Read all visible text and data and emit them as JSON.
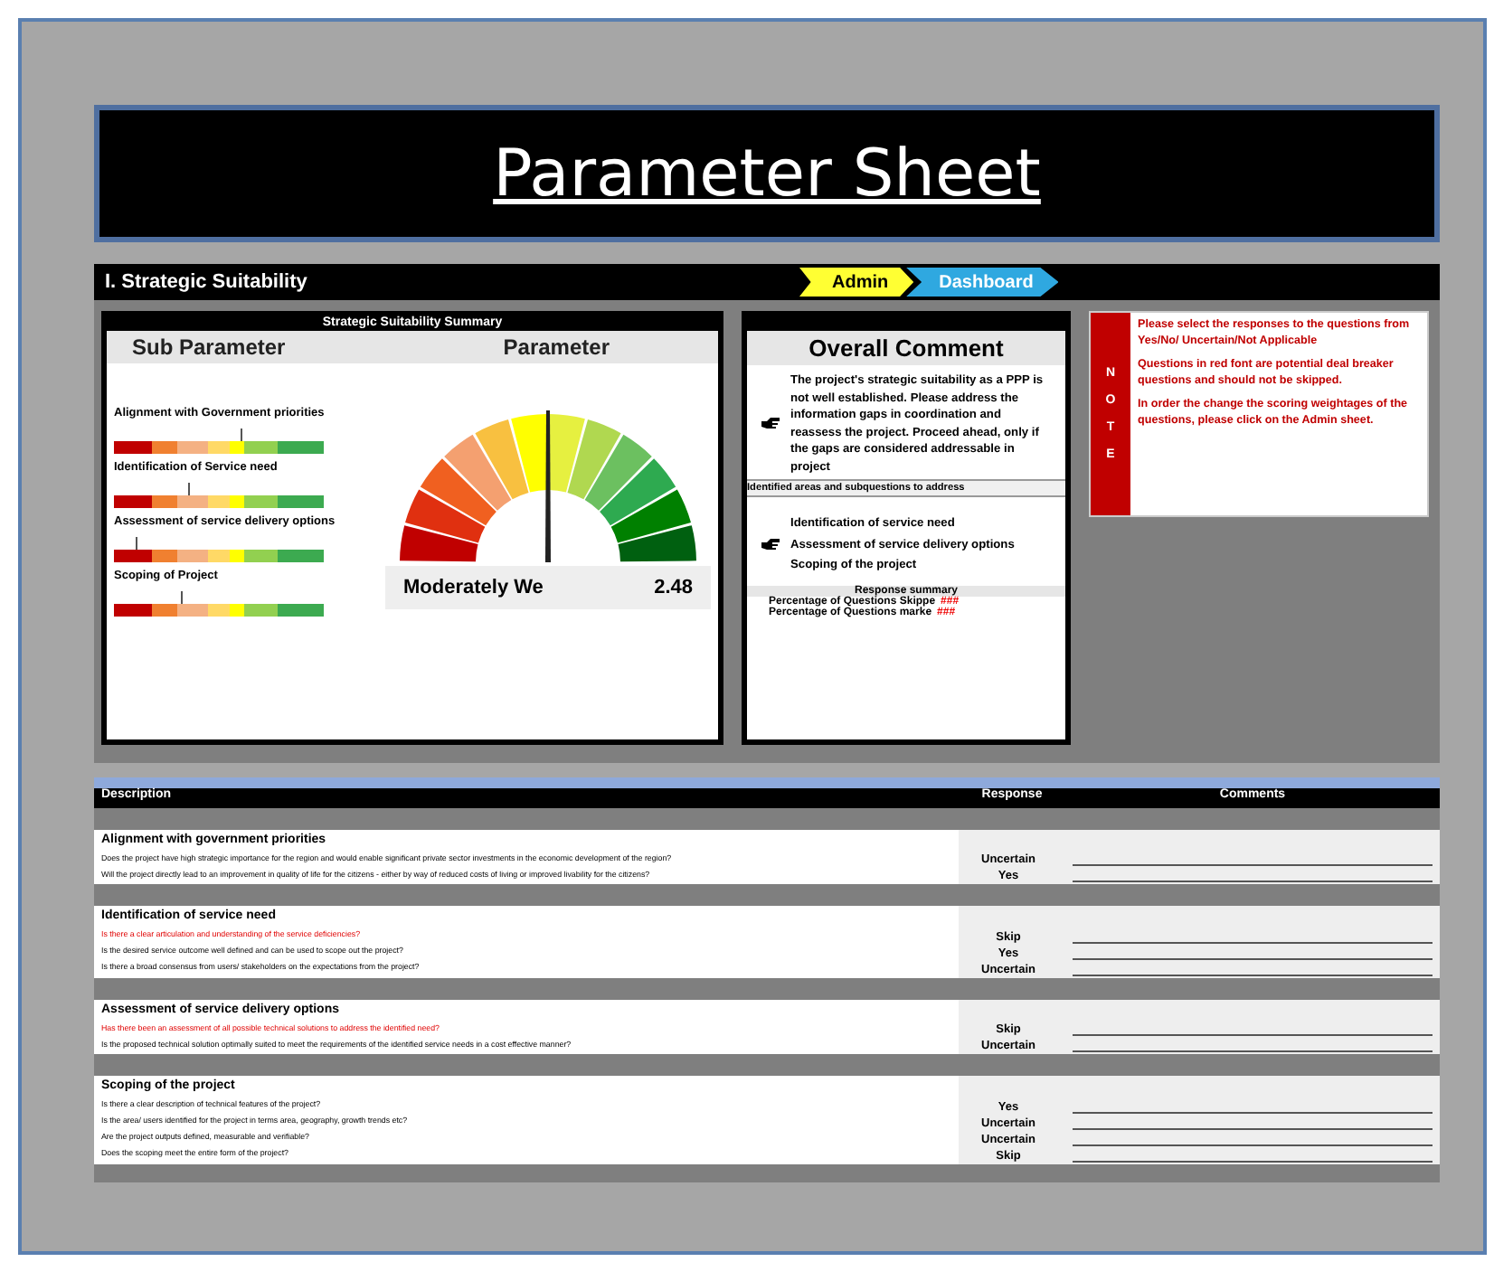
{
  "title": "Parameter Sheet",
  "section": {
    "title": "I. Strategic Suitability",
    "tabs": [
      {
        "label": "Admin",
        "kind": "admin"
      },
      {
        "label": "Dashboard",
        "kind": "dashboard"
      }
    ]
  },
  "summary": {
    "title": "Strategic Suitability Summary",
    "sub_heading": "Sub Parameter",
    "param_heading": "Parameter",
    "sub_parameters": [
      {
        "name": "Alignment with Government priorities",
        "level": 0.6
      },
      {
        "name": "Identification of Service need",
        "level": 0.35
      },
      {
        "name": "Assessment of service delivery options",
        "level": 0.1
      },
      {
        "name": "Scoping of Project",
        "level": 0.32
      }
    ],
    "gauge": {
      "rating": "Moderately We",
      "score": "2.48"
    }
  },
  "comment": {
    "title": "Overall Comment",
    "text": "The project's strategic suitability as a PPP is not well established. Please address the information gaps in coordination and reassess the project. Proceed ahead, only if the gaps are considered addressable in project",
    "areas_heading": "Identified areas and subquestions to address",
    "areas": [
      "Identification of service need",
      "Assessment of service delivery options",
      "Scoping of the project"
    ],
    "summary_title": "Response summary",
    "stats": [
      {
        "label": "Percentage of Questions Skippe",
        "value": "###"
      },
      {
        "label": "Percentage of Questions marke",
        "value": "###"
      }
    ]
  },
  "note": {
    "letters": [
      "N",
      "O",
      "T",
      "E"
    ],
    "paragraphs": [
      "Please select the responses to the questions from Yes/No/ Uncertain/Not Applicable",
      "Questions in red font are potential deal breaker questions and should not be skipped.",
      "In order the change the scoring weightages of the questions, please click on the Admin sheet."
    ]
  },
  "table": {
    "columns": [
      "Description",
      "Response",
      "Comments"
    ],
    "groups": [
      {
        "title": "Alignment with government priorities",
        "questions": [
          {
            "text": "Does the project have high strategic importance for the region and would enable significant private sector investments in the economic development of the region?",
            "critical": false,
            "response": "Uncertain"
          },
          {
            "text": "Will the project directly lead to an improvement in quality of life for the citizens - either by way of reduced costs of living or improved livability for the citizens?",
            "critical": false,
            "response": "Yes"
          }
        ]
      },
      {
        "title": "Identification of service need",
        "questions": [
          {
            "text": "Is there a clear articulation and understanding of the service deficiencies?",
            "critical": true,
            "response": "Skip"
          },
          {
            "text": "Is the desired service outcome well defined and can be used to scope out the project?",
            "critical": false,
            "response": "Yes"
          },
          {
            "text": "Is there a broad consensus from users/ stakeholders on the expectations from the project?",
            "critical": false,
            "response": "Uncertain"
          }
        ]
      },
      {
        "title": "Assessment of service delivery options",
        "questions": [
          {
            "text": "Has there been an assessment of all possible technical solutions to address the identified need?",
            "critical": true,
            "response": "Skip"
          },
          {
            "text": "Is the proposed technical solution optimally suited to meet the requirements of the identified service needs in a cost effective manner?",
            "critical": false,
            "response": "Uncertain"
          }
        ]
      },
      {
        "title": "Scoping of the project",
        "questions": [
          {
            "text": "Is there a clear description of technical features of the project?",
            "critical": false,
            "response": "Yes"
          },
          {
            "text": "Is the area/ users identified for the project in terms area, geography, growth trends etc?",
            "critical": false,
            "response": "Uncertain"
          },
          {
            "text": "Are the project outputs defined, measurable and verifiable?",
            "critical": false,
            "response": "Uncertain"
          },
          {
            "text": "Does the scoping meet the entire form of the project?",
            "critical": false,
            "response": "Skip"
          }
        ]
      }
    ]
  }
}
